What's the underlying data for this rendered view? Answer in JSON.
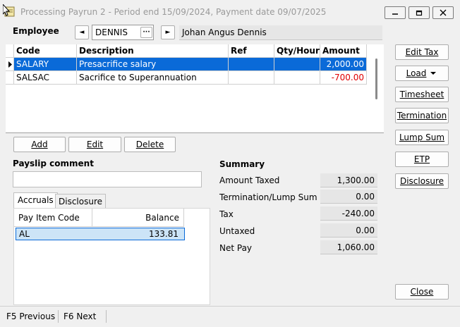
{
  "window": {
    "title": "Processing Payrun 2 - Period end 15/09/2024, Payment date 09/07/2025"
  },
  "employee": {
    "label": "Employee",
    "code": "DENNIS",
    "name": "Johan Angus Dennis",
    "lookup_label": "···",
    "prev_label": "◄",
    "next_label": "►"
  },
  "grid": {
    "columns": [
      "Code",
      "Description",
      "Ref",
      "Qty/Hours",
      "Amount"
    ],
    "rows": [
      {
        "code": "SALARY",
        "description": "Presacrifice salary",
        "ref": "",
        "qty": "",
        "amount": "2,000.00"
      },
      {
        "code": "SALSAC",
        "description": "Sacrifice to Superannuation",
        "ref": "",
        "qty": "",
        "amount": "-700.00"
      }
    ]
  },
  "grid_buttons": {
    "add": "Add",
    "edit": "Edit",
    "delete": "Delete"
  },
  "side_buttons": {
    "edit_tax": "Edit Tax",
    "load": "Load",
    "timesheet": "Timesheet",
    "termination": "Termination",
    "lump_sum": "Lump Sum",
    "etp": "ETP",
    "disclosure": "Disclosure",
    "close": "Close"
  },
  "payslip": {
    "label": "Payslip comment",
    "value": ""
  },
  "tabs": {
    "accruals": "Accruals",
    "disclosure": "Disclosure"
  },
  "accruals": {
    "columns": [
      "Pay Item Code",
      "Balance"
    ],
    "rows": [
      {
        "code": "AL",
        "balance": "133.81"
      }
    ]
  },
  "summary": {
    "title": "Summary",
    "items": [
      {
        "label": "Amount Taxed",
        "value": "1,300.00"
      },
      {
        "label": "Termination/Lump Sum",
        "value": "0.00"
      },
      {
        "label": "Tax",
        "value": "-240.00"
      },
      {
        "label": "Untaxed",
        "value": "0.00"
      },
      {
        "label": "Net Pay",
        "value": "1,060.00"
      }
    ]
  },
  "statusbar": {
    "prev": "F5 Previous",
    "next": "F6 Next"
  },
  "colors": {
    "selection": "#0a6ad8",
    "negative": "#e00000"
  }
}
